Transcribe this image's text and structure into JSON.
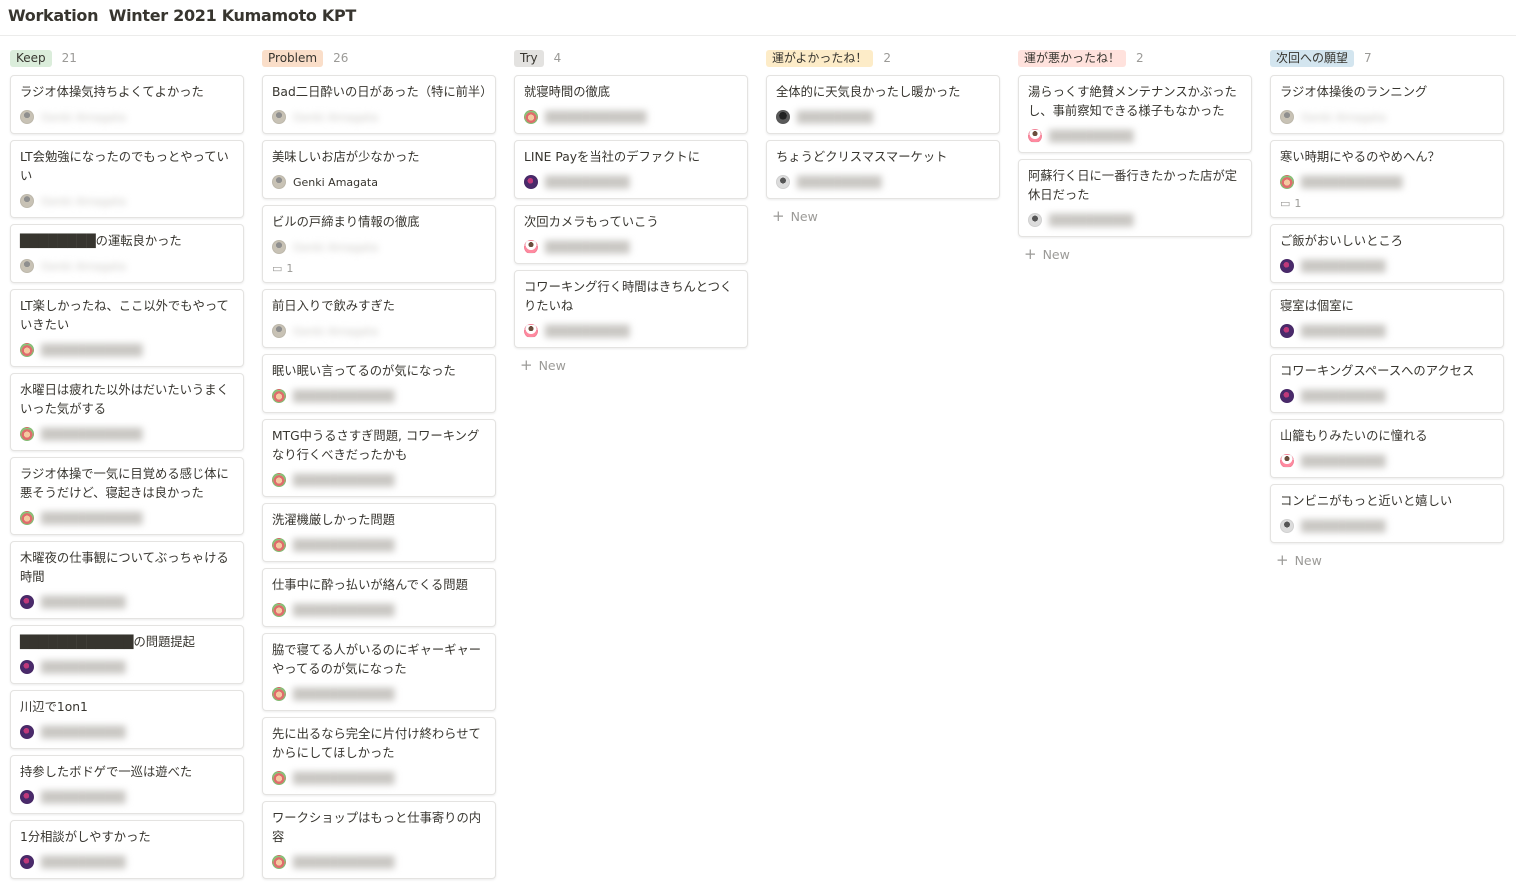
{
  "page": {
    "title": "Workation  Winter 2021 Kumamoto KPT"
  },
  "new_label": "New",
  "columns": [
    {
      "name": "Keep",
      "count": "21",
      "tag_color": "#dbeddb",
      "cards": [
        {
          "title": "ラジオ体操気持ちよくてよかった",
          "avatar": "gray",
          "person": "Genki Amagata",
          "person_visible": false
        },
        {
          "title": "LT会勉強になったのでもっとやっていい",
          "avatar": "gray",
          "person": "Genki Amagata",
          "person_visible": false
        },
        {
          "title": "████████の運転良かった",
          "avatar": "gray",
          "person": "Genki Amagata",
          "person_visible": false
        },
        {
          "title": "LT楽しかったね、ここ以外でもやっていきたい",
          "avatar": "cartoon",
          "person": "████████████",
          "person_visible": false
        },
        {
          "title": "水曜日は疲れた以外はだいたいうまくいった気がする",
          "avatar": "cartoon",
          "person": "████████████",
          "person_visible": false
        },
        {
          "title": "ラジオ体操で一気に目覚める感じ体に悪そうだけど、寝起きは良かった",
          "avatar": "cartoon",
          "person": "████████████",
          "person_visible": false
        },
        {
          "title": "木曜夜の仕事観についてぶっちゃける時間",
          "avatar": "purple",
          "person": "██████████",
          "person_visible": false
        },
        {
          "title": "████████████の問題提起",
          "avatar": "purple",
          "person": "██████████",
          "person_visible": false
        },
        {
          "title": "川辺で1on1",
          "avatar": "purple",
          "person": "██████████",
          "person_visible": false
        },
        {
          "title": "持参したボドゲで一巡は遊べた",
          "avatar": "purple",
          "person": "██████████",
          "person_visible": false
        },
        {
          "title": "1分相談がしやすかった",
          "avatar": "purple",
          "person": "██████████",
          "person_visible": false
        }
      ]
    },
    {
      "name": "Problem",
      "count": "26",
      "tag_color": "#fadec9",
      "cards": [
        {
          "title": "Bad二日酔いの日があった（特に前半）",
          "avatar": "gray",
          "person": "Genki Amagata",
          "person_visible": false
        },
        {
          "title": "美味しいお店が少なかった",
          "avatar": "gray",
          "person": "Genki Amagata",
          "person_visible": true
        },
        {
          "title": "ビルの戸締まり情報の徹底",
          "avatar": "gray",
          "person": "Genki Amagata",
          "person_visible": false,
          "comments": "1"
        },
        {
          "title": "前日入りで飲みすぎた",
          "avatar": "gray",
          "person": "Genki Amagata",
          "person_visible": false
        },
        {
          "title": "眠い眠い言ってるのが気になった",
          "avatar": "cartoon",
          "person": "████████████",
          "person_visible": false
        },
        {
          "title": "MTG中うるさすぎ問題, コワーキングなり行くべきだったかも",
          "avatar": "cartoon",
          "person": "████████████",
          "person_visible": false
        },
        {
          "title": "洗濯機厳しかった問題",
          "avatar": "cartoon",
          "person": "████████████",
          "person_visible": false
        },
        {
          "title": "仕事中に酔っ払いが絡んでくる問題",
          "avatar": "cartoon",
          "person": "████████████",
          "person_visible": false
        },
        {
          "title": "脇で寝てる人がいるのにギャーギャーやってるのが気になった",
          "avatar": "cartoon",
          "person": "████████████",
          "person_visible": false
        },
        {
          "title": "先に出るなら完全に片付け終わらせてからにしてほしかった",
          "avatar": "cartoon",
          "person": "████████████",
          "person_visible": false
        },
        {
          "title": "ワークショップはもっと仕事寄りの内容",
          "avatar": "cartoon",
          "person": "████████████",
          "person_visible": false
        }
      ]
    },
    {
      "name": "Try",
      "count": "4",
      "tag_color": "#e3e2e0",
      "cards": [
        {
          "title": "就寝時間の徹底",
          "avatar": "cartoon",
          "person": "████████████",
          "person_visible": false
        },
        {
          "title": "LINE Payを当社のデファクトに",
          "avatar": "purple",
          "person": "██████████",
          "person_visible": false
        },
        {
          "title": "次回カメラもっていこう",
          "avatar": "person",
          "person": "██████████",
          "person_visible": false
        },
        {
          "title": "コワーキング行く時間はきちんとつくりたいね",
          "avatar": "person",
          "person": "██████████",
          "person_visible": false
        }
      ]
    },
    {
      "name": "運がよかったね！",
      "count": "2",
      "tag_color": "#fdecc8",
      "cards": [
        {
          "title": "全体的に天気良かったし暖かった",
          "avatar": "dark",
          "person": "█████████",
          "person_visible": false
        },
        {
          "title": "ちょうどクリスマスマーケット",
          "avatar": "bw",
          "person": "██████████",
          "person_visible": false
        }
      ]
    },
    {
      "name": "運が悪かったね！",
      "count": "2",
      "tag_color": "#ffe2dd",
      "cards": [
        {
          "title": "湯らっくす絶賛メンテナンスかぶったし、事前察知できる様子もなかった",
          "avatar": "person",
          "person": "██████████",
          "person_visible": false
        },
        {
          "title": "阿蘇行く日に一番行きたかった店が定休日だった",
          "avatar": "bw",
          "person": "██████████",
          "person_visible": false
        }
      ]
    },
    {
      "name": "次回への願望",
      "count": "7",
      "tag_color": "#d3e5ef",
      "cards": [
        {
          "title": "ラジオ体操後のランニング",
          "avatar": "gray",
          "person": "Genki Amagata",
          "person_visible": false
        },
        {
          "title": "寒い時期にやるのやめへん？",
          "avatar": "cartoon",
          "person": "████████████",
          "person_visible": false,
          "comments": "1"
        },
        {
          "title": "ご飯がおいしいところ",
          "avatar": "purple",
          "person": "██████████",
          "person_visible": false
        },
        {
          "title": "寝室は個室に",
          "avatar": "purple",
          "person": "██████████",
          "person_visible": false
        },
        {
          "title": "コワーキングスペースへのアクセス",
          "avatar": "purple",
          "person": "██████████",
          "person_visible": false
        },
        {
          "title": "山籠もりみたいのに憧れる",
          "avatar": "person",
          "person": "██████████",
          "person_visible": false
        },
        {
          "title": "コンビニがもっと近いと嬉しい",
          "avatar": "bw",
          "person": "██████████",
          "person_visible": false
        }
      ]
    }
  ]
}
